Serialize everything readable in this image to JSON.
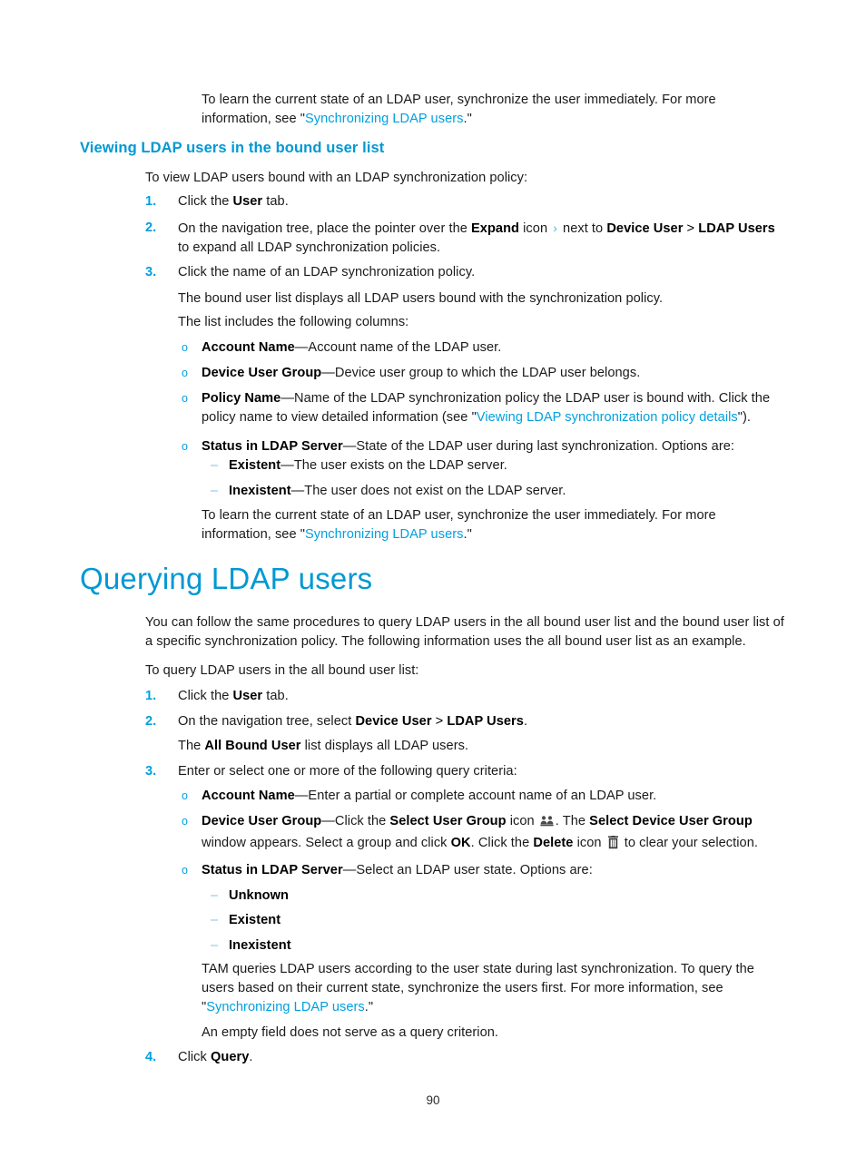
{
  "document": {
    "page_number": "90",
    "accent_color": "#00A0DF",
    "heading_color": "#0098D4",
    "link_color": "#00A0DF"
  },
  "intro_note": {
    "line1": "To learn the current state of an LDAP user, synchronize the user immediately. For more",
    "line2_prefix": "information, see \"",
    "link": "Synchronizing LDAP users",
    "line2_suffix": ".\""
  },
  "section_viewing": {
    "heading": "Viewing LDAP users in the bound user list",
    "lead": "To view LDAP users bound with an LDAP synchronization policy:",
    "steps": [
      {
        "num": "1.",
        "pre": "Click the ",
        "bold": "User",
        "post": " tab."
      },
      {
        "num": "2.",
        "part1": "On the navigation tree, place the pointer over the ",
        "bold1": "Expand",
        "part2": " icon ",
        "icon": "chevron-right-icon",
        "part3": " next to ",
        "bold2": "Device User",
        "sep": " > ",
        "bold3": "LDAP Users",
        "part4": "to expand all LDAP synchronization policies."
      },
      {
        "num": "3.",
        "text": "Click the name of an LDAP synchronization policy."
      }
    ],
    "after_step3_line1": "The bound user list displays all LDAP users bound with the synchronization policy.",
    "after_step3_line2": "The list includes the following columns:",
    "columns": [
      {
        "marker": "o",
        "term": "Account Name",
        "desc": "—Account name of the LDAP user."
      },
      {
        "marker": "o",
        "term": "Device User Group",
        "desc": "—Device user group to which the LDAP user belongs."
      },
      {
        "marker": "o",
        "term": "Policy Name",
        "desc_a": "—Name of the LDAP synchronization policy the LDAP user is bound with. Click the policy name to view detailed information (see \"",
        "link": "Viewing LDAP synchronization policy details",
        "desc_b": "\")."
      },
      {
        "marker": "o",
        "term": "Status in LDAP Server",
        "desc": "—State of the LDAP user during last synchronization. Options are:"
      }
    ],
    "status_options": [
      {
        "marker": "–",
        "term": "Existent",
        "desc": "—The user exists on the LDAP server."
      },
      {
        "marker": "–",
        "term": "Inexistent",
        "desc": "—The user does not exist on the LDAP server."
      }
    ],
    "closing": {
      "line1": "To learn the current state of an LDAP user, synchronize the user immediately. For more",
      "line2_prefix": "information, see \"",
      "link": "Synchronizing LDAP users",
      "line2_suffix": ".\""
    }
  },
  "section_querying": {
    "heading": "Querying LDAP users",
    "intro": "You can follow the same procedures to query LDAP users in the all bound user list and the bound user list of a specific synchronization policy. The following information uses the all bound user list as an example.",
    "lead": "To query LDAP users in the all bound user list:",
    "steps": [
      {
        "num": "1.",
        "pre": "Click the ",
        "bold": "User",
        "post": " tab."
      },
      {
        "num": "2.",
        "pre": "On the navigation tree, select ",
        "bold1": "Device User",
        "sep": " > ",
        "bold2": "LDAP Users",
        "post": ".",
        "sub_pre": "The ",
        "sub_bold": "All Bound User",
        "sub_post": " list displays all LDAP users."
      },
      {
        "num": "3.",
        "text": "Enter or select one or more of the following query criteria:"
      },
      {
        "num": "4.",
        "pre": "Click ",
        "bold": "Query",
        "post": "."
      }
    ],
    "criteria": [
      {
        "marker": "o",
        "term": "Account Name",
        "desc": "—Enter a partial or complete account name of an LDAP user."
      },
      {
        "marker": "o",
        "term": "Device User Group",
        "p1": "—Click the ",
        "b1": "Select User Group",
        "p2": " icon ",
        "icon1": "user-group-icon",
        "p3": ". The ",
        "b2": "Select Device User Group",
        "p4": " window appears. Select a group and click ",
        "b3": "OK",
        "p5": ". Click the ",
        "b4": "Delete",
        "p6": " icon ",
        "icon2": "trash-icon",
        "p7": " to clear your selection."
      },
      {
        "marker": "o",
        "term": "Status in LDAP Server",
        "desc": "—Select an LDAP user state. Options are:"
      }
    ],
    "status_options": [
      {
        "marker": "–",
        "term": "Unknown"
      },
      {
        "marker": "–",
        "term": "Existent"
      },
      {
        "marker": "–",
        "term": "Inexistent"
      }
    ],
    "tam_note": {
      "line1": "TAM queries LDAP users according to the user state during last synchronization. To query the",
      "line2": "users based on their current state, synchronize the users first. For more information, see",
      "line3_prefix": "\"",
      "link": "Synchronizing LDAP users",
      "line3_suffix": ".\""
    },
    "empty_field_note": "An empty field does not serve as a query criterion."
  }
}
